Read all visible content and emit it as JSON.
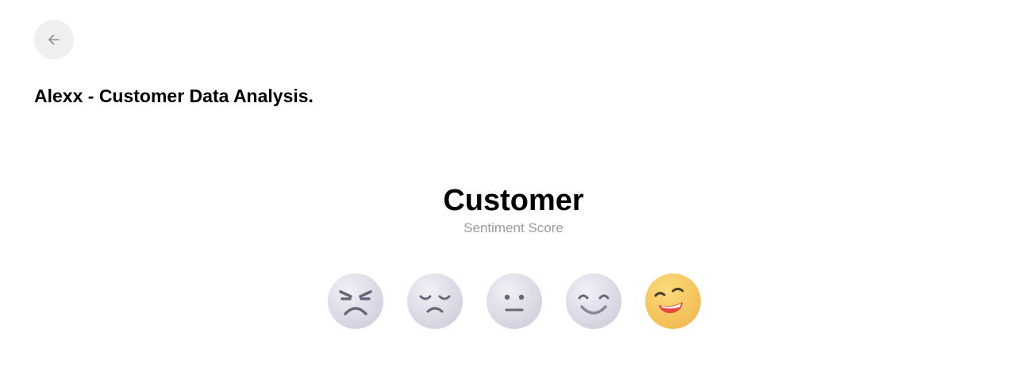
{
  "header": {
    "back_icon": "arrow-left-icon",
    "title": "Alexx - Customer Data Analysis."
  },
  "main": {
    "heading": "Customer",
    "subheading": "Sentiment Score"
  },
  "sentiment": {
    "options": [
      {
        "icon": "angry-face-icon",
        "selected": false
      },
      {
        "icon": "sad-face-icon",
        "selected": false
      },
      {
        "icon": "neutral-face-icon",
        "selected": false
      },
      {
        "icon": "smiling-face-icon",
        "selected": false
      },
      {
        "icon": "grinning-face-icon",
        "selected": true
      }
    ]
  },
  "colors": {
    "inactive_face": "#dcdae6",
    "active_face": "#f7c95a",
    "feature": "#68667a",
    "active_mouth": "#e8453c",
    "subheading": "#9b9b9b",
    "back_button_bg": "#efefef"
  }
}
